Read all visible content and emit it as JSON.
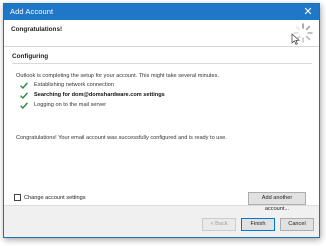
{
  "window": {
    "title": "Add Account",
    "close_glyph": "✕"
  },
  "header": {
    "heading": "Congratulations!",
    "spinner_icon": "busy-spinner-icon"
  },
  "configuring": {
    "section_title": "Configuring",
    "intro": "Outlook is completing the setup for your account. This might take several minutes.",
    "steps": [
      {
        "label": "Establishing network connection",
        "status": "done",
        "bold": false
      },
      {
        "label": "Searching for dom@domshardware.com settings",
        "status": "done",
        "bold": true
      },
      {
        "label": "Logging on to the mail server",
        "status": "done",
        "bold": false
      }
    ],
    "success_message": "Congratulations! Your email account was successfully configured and is ready to use."
  },
  "options": {
    "change_settings_label": "Change account settings",
    "change_settings_checked": false,
    "add_another_label": "Add another account..."
  },
  "footer": {
    "back_label": "< Back",
    "finish_label": "Finish",
    "cancel_label": "Cancel"
  },
  "colors": {
    "titlebar": "#1f77c8",
    "check": "#2e8b3e",
    "primary_border": "#0078d7"
  }
}
